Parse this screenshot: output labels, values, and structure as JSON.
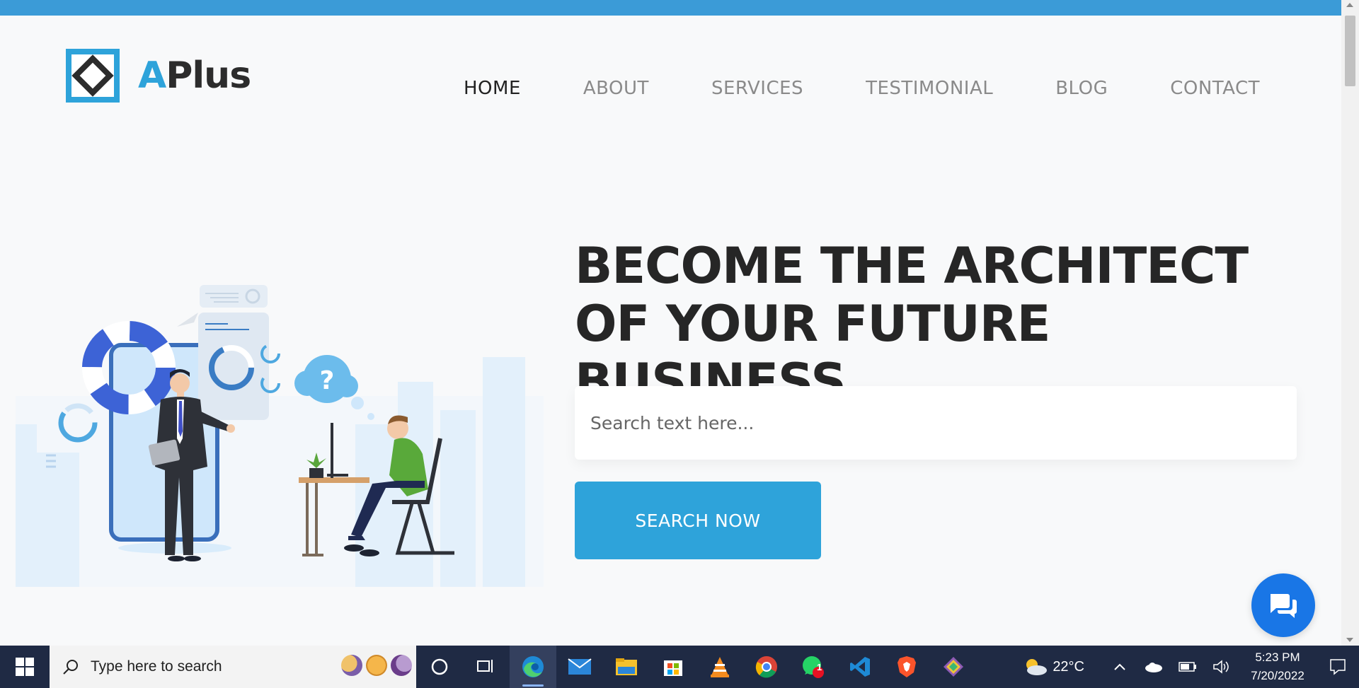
{
  "brand": {
    "letter": "A",
    "rest": "Plus",
    "color": "#2ea3da"
  },
  "nav": {
    "items": [
      {
        "label": "HOME",
        "active": true
      },
      {
        "label": "ABOUT",
        "active": false
      },
      {
        "label": "SERVICES",
        "active": false
      },
      {
        "label": "TESTIMONIAL",
        "active": false
      },
      {
        "label": "BLOG",
        "active": false
      },
      {
        "label": "CONTACT",
        "active": false
      }
    ]
  },
  "hero": {
    "title_line1": "BECOME THE ARCHITECT",
    "title_line2": "OF YOUR FUTURE BUSINESS",
    "illustration": "business-people-illustration"
  },
  "search": {
    "placeholder": "Search text here...",
    "value": "",
    "button_label": "SEARCH NOW"
  },
  "chat": {
    "icon": "chat-bubbles-icon"
  },
  "taskbar": {
    "search_placeholder": "Type here to search",
    "apps": [
      "cortana-icon",
      "task-view-icon",
      "edge-icon",
      "mail-icon",
      "file-explorer-icon",
      "store-icon",
      "vlc-icon",
      "chrome-icon",
      "whatsapp-icon",
      "vscode-icon",
      "brave-icon",
      "git-icon"
    ],
    "whatsapp_badge": "1",
    "weather": "22°C",
    "time": "5:23 PM",
    "date": "7/20/2022"
  },
  "colors": {
    "accent": "#2ea3da",
    "topbar": "#3b9bd7",
    "chat": "#1976e6",
    "taskbar": "#1f2a44"
  }
}
